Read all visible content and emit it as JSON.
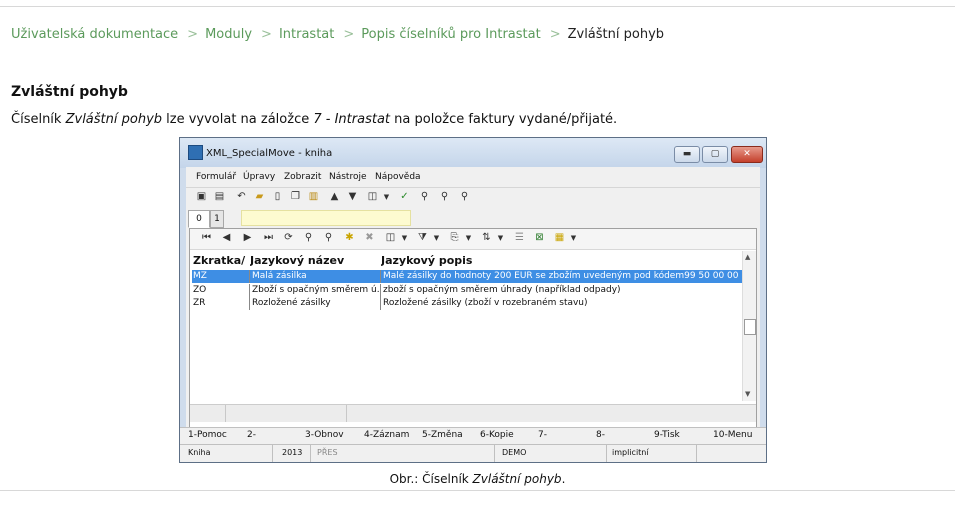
{
  "breadcrumb": {
    "items": [
      "Uživatelská dokumentace",
      "Moduly",
      "Intrastat",
      "Popis číselníků pro Intrastat"
    ],
    "current": "Zvláštní pohyb",
    "separator": ">"
  },
  "page": {
    "title": "Zvláštní pohyb",
    "intro_prefix": "Číselník ",
    "intro_em1": "Zvláštní pohyb",
    "intro_mid": " lze vyvolat na záložce ",
    "intro_em2": "7 - Intrastat",
    "intro_suffix": " na položce faktury vydané/přijaté.",
    "caption_prefix": "Obr.: Číselník ",
    "caption_em": "Zvláštní pohyb",
    "caption_suffix": "."
  },
  "window": {
    "title": "XML_SpecialMove - kniha",
    "buttons": {
      "minimize": "▬",
      "maximize": "▢",
      "close": "✕"
    },
    "menu": [
      "Formulář",
      "Úpravy",
      "Zobrazit",
      "Nástroje",
      "Nápověda"
    ],
    "tabs": [
      "0",
      "1"
    ],
    "columns": [
      "Zkratka/",
      "Jazykový název",
      "Jazykový popis"
    ],
    "rows": [
      {
        "code": "MZ",
        "name": "Malá zásilka",
        "desc": "Malé zásilky do hodnoty 200 EUR se zbožím uvedeným pod kódem99 50 00 00",
        "selected": true
      },
      {
        "code": "ZO",
        "name": "Zboží s opačným směrem ú...",
        "desc": "zboží s opačným směrem úhrady (například odpady)",
        "selected": false
      },
      {
        "code": "ZR",
        "name": "Rozložené zásilky",
        "desc": "Rozložené zásilky (zboží v rozebraném stavu)",
        "selected": false
      }
    ],
    "function_keys": [
      "1-Pomoc",
      "2-",
      "3-Obnov",
      "4-Záznam",
      "5-Změna",
      "6-Kopie",
      "7-",
      "8-",
      "9-Tisk",
      "10-Menu"
    ],
    "status": {
      "book": "Kniha",
      "year": "2013",
      "mode": "PŘES",
      "db": "DEMO",
      "setting": "implicitní"
    }
  },
  "icons": {
    "toolbar1": [
      "save-icon",
      "save-all-icon",
      "undo-icon",
      "open-folder-icon",
      "new-document-icon",
      "copy-icon",
      "book-icon",
      "arrow-up-icon",
      "arrow-down-icon",
      "window-dropdown-icon",
      "tick-icon",
      "find-icon",
      "find-next-icon",
      "find-prev-icon"
    ],
    "toolbar2": [
      "first-record-icon",
      "prev-record-icon",
      "next-record-icon",
      "last-record-icon",
      "refresh-icon",
      "find-icon",
      "find-edit-icon",
      "add-star-icon",
      "delete-icon",
      "window-dropdown-icon",
      "filter-icon",
      "export-icon",
      "sort-icon",
      "list-icon",
      "excel-icon",
      "calculator-icon"
    ]
  },
  "colors": {
    "link": "#5b9a5b",
    "selection": "#3e8ee4",
    "tabfield": "#fdfbd0"
  }
}
